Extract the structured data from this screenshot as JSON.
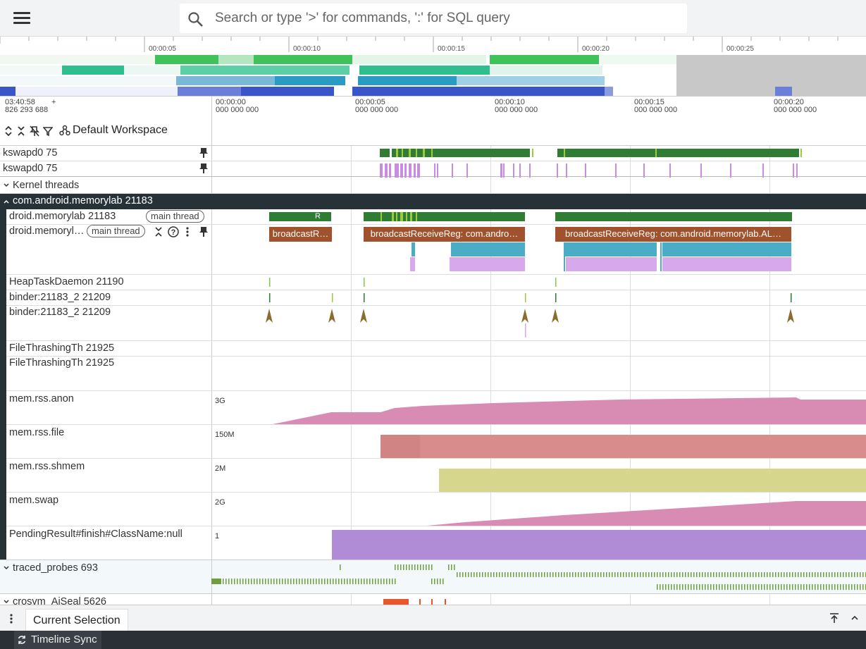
{
  "search": {
    "placeholder": "Search or type '>' for commands, ':' for SQL query"
  },
  "overview": {
    "ticks": [
      "00:00:05",
      "00:00:10",
      "00:00:15",
      "00:00:20",
      "00:00:25"
    ]
  },
  "timeline": {
    "origin_time": "03:40:58",
    "origin_ns": "826 293 688",
    "plus": "+",
    "ticks": [
      {
        "t": "00:00:00",
        "ns": "000 000 000"
      },
      {
        "t": "00:00:05",
        "ns": "000 000 000"
      },
      {
        "t": "00:00:10",
        "ns": "000 000 000"
      },
      {
        "t": "00:00:15",
        "ns": "000 000 000"
      },
      {
        "t": "00:00:20",
        "ns": "000 000 000"
      }
    ]
  },
  "workspace": {
    "name": "Default Workspace"
  },
  "pinned": [
    {
      "name": "kswapd0 75"
    },
    {
      "name": "kswapd0 75"
    }
  ],
  "groups": {
    "kernel": "Kernel threads",
    "process": "com.android.memorylab 21183",
    "traced": "traced_probes 693",
    "crosvm": "crosvm_AiSeal 5626"
  },
  "threads": {
    "main": "droid.memorylab 21183",
    "main_pill": "main thread",
    "main_slice_state": "R",
    "main2": "droid.memoryl…",
    "main2_pill": "main thread",
    "slices": [
      "broadcastR…",
      "broadcastReceiveReg: com.andro…",
      "broadcastReceiveReg: com.android.memorylab.AL…"
    ],
    "heap": "HeapTaskDaemon 21190",
    "binder1": "binder:21183_2 21209",
    "binder2": "binder:21183_2 21209",
    "file1": "FileThrashingTh 21925",
    "file2": "FileThrashingTh 21925"
  },
  "counters": [
    {
      "name": "mem.rss.anon",
      "scale": "3G",
      "color": "#d98cb3"
    },
    {
      "name": "mem.rss.file",
      "scale": "150M",
      "color": "#d98c8c"
    },
    {
      "name": "mem.rss.shmem",
      "scale": "2M",
      "color": "#d6d68c"
    },
    {
      "name": "mem.swap",
      "scale": "2G",
      "color": "#d98cb3"
    },
    {
      "name": "PendingResult#finish#ClassName:null",
      "scale": "1",
      "color": "#b08cd6"
    }
  ],
  "bottom": {
    "tab": "Current Selection",
    "status": "Timeline Sync"
  },
  "colors": {
    "green": "#388e3c",
    "brown": "#a0522d",
    "cyan": "#4aacc6",
    "lilac": "#d6a6e8",
    "dark": "#263238"
  }
}
